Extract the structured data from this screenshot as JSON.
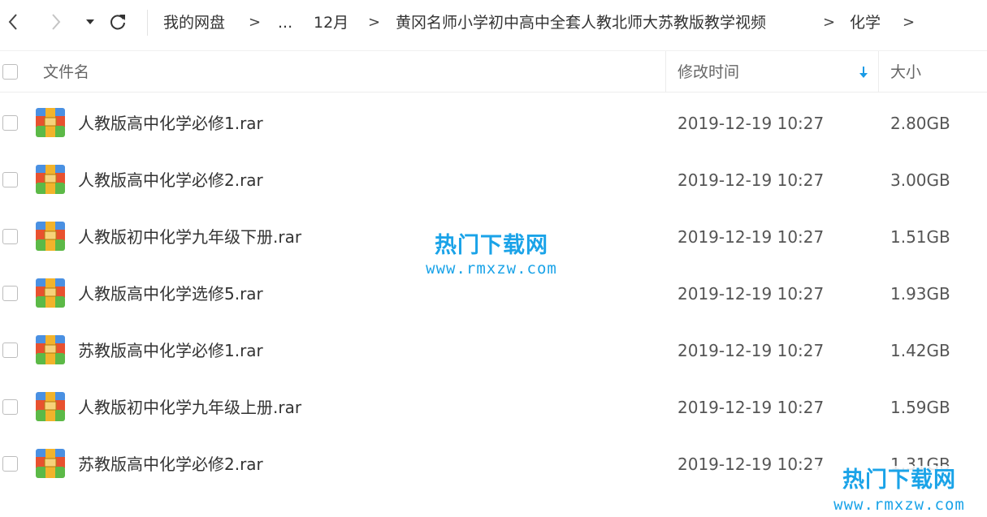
{
  "nav": {
    "back_icon": "chevron-left-icon",
    "forward_icon": "chevron-right-icon",
    "history_icon": "caret-down-icon",
    "refresh_icon": "refresh-icon"
  },
  "breadcrumb": {
    "items": [
      "我的网盘",
      "...",
      "12月",
      "黄冈名师小学初中高中全套人教北师大苏教版教学视频",
      "化学"
    ],
    "separator": ">"
  },
  "list_header": {
    "name": "文件名",
    "modified": "修改时间",
    "size": "大小",
    "sort_icon": "arrow-down-icon",
    "sort_color": "#1a9be6"
  },
  "files": [
    {
      "name": "人教版高中化学必修1.rar",
      "modified": "2019-12-19 10:27",
      "size": "2.80GB",
      "icon": "rar-archive-icon"
    },
    {
      "name": "人教版高中化学必修2.rar",
      "modified": "2019-12-19 10:27",
      "size": "3.00GB",
      "icon": "rar-archive-icon"
    },
    {
      "name": "人教版初中化学九年级下册.rar",
      "modified": "2019-12-19 10:27",
      "size": "1.51GB",
      "icon": "rar-archive-icon"
    },
    {
      "name": "人教版高中化学选修5.rar",
      "modified": "2019-12-19 10:27",
      "size": "1.93GB",
      "icon": "rar-archive-icon"
    },
    {
      "name": "苏教版高中化学必修1.rar",
      "modified": "2019-12-19 10:27",
      "size": "1.42GB",
      "icon": "rar-archive-icon"
    },
    {
      "name": "人教版初中化学九年级上册.rar",
      "modified": "2019-12-19 10:27",
      "size": "1.59GB",
      "icon": "rar-archive-icon"
    },
    {
      "name": "苏教版高中化学必修2.rar",
      "modified": "2019-12-19 10:27",
      "size": "1.31GB",
      "icon": "rar-archive-icon"
    }
  ],
  "watermark": {
    "title": "热门下载网",
    "url": "www.rmxzw.com",
    "color": "#1aa3e8"
  }
}
